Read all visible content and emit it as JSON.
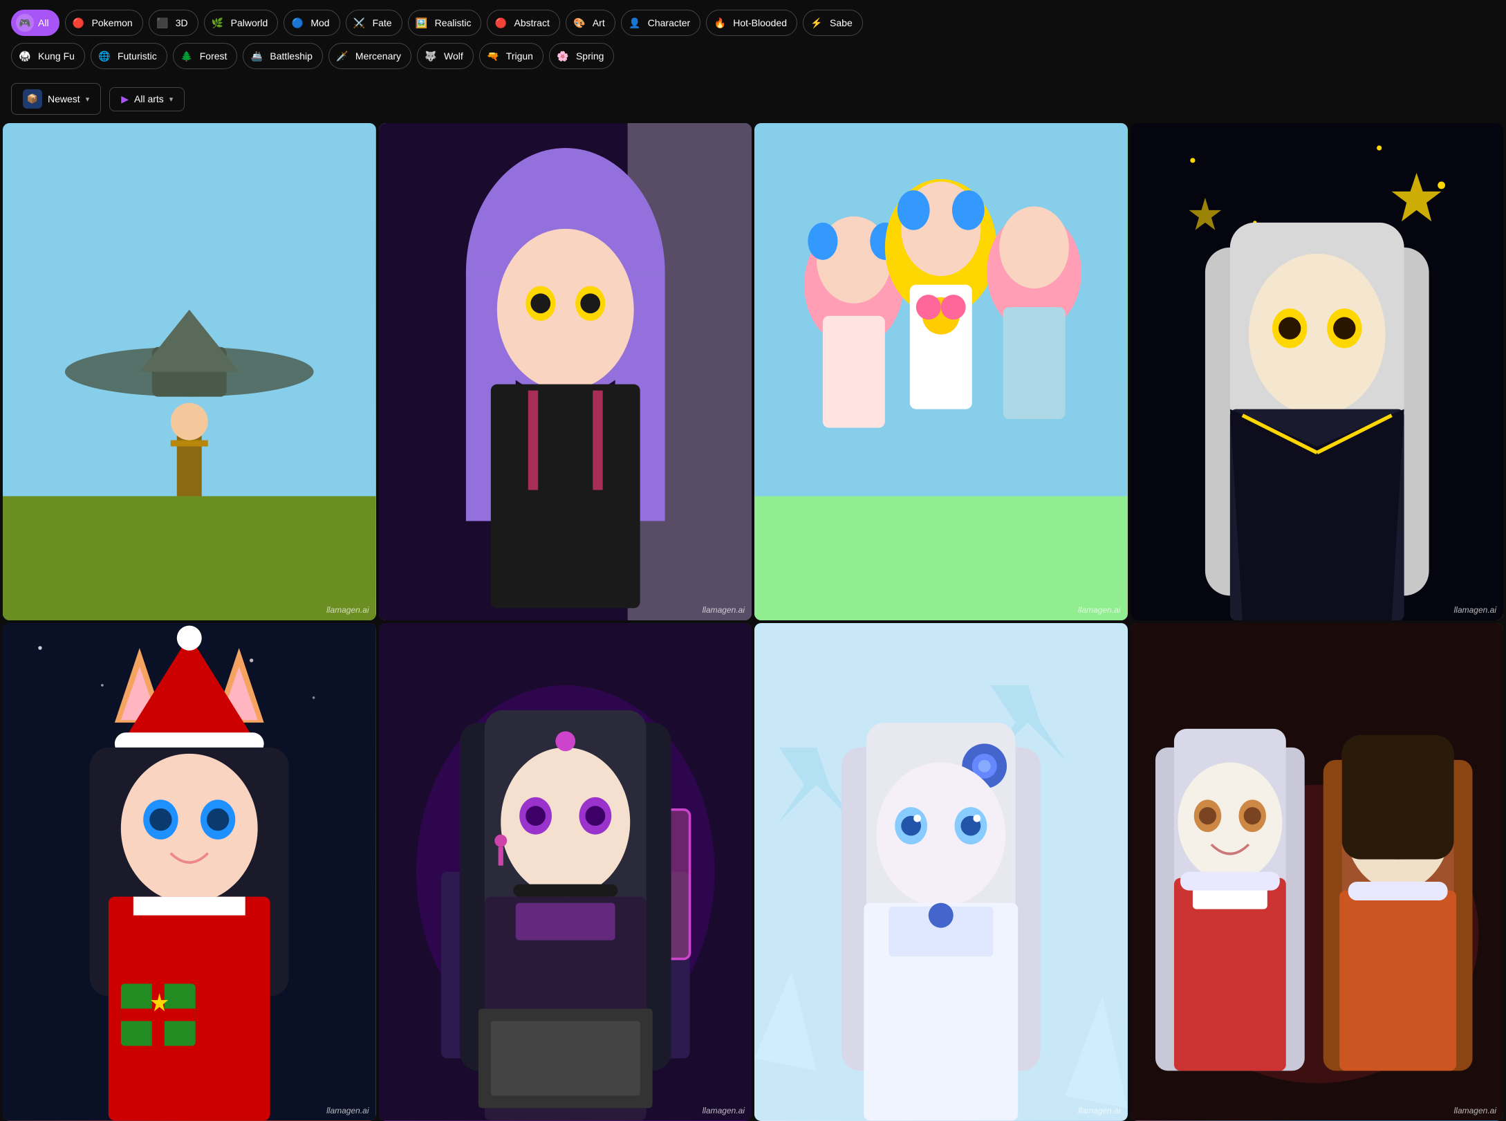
{
  "categories_row1": [
    {
      "id": "all",
      "label": "All",
      "icon": "🎮",
      "active": true
    },
    {
      "id": "pokemon",
      "label": "Pokemon",
      "icon": "🔴"
    },
    {
      "id": "3d",
      "label": "3D",
      "icon": "⬛"
    },
    {
      "id": "palworld",
      "label": "Palworld",
      "icon": "🌿"
    },
    {
      "id": "mod",
      "label": "Mod",
      "icon": "🔵"
    },
    {
      "id": "fate",
      "label": "Fate",
      "icon": "⚔️"
    },
    {
      "id": "realistic",
      "label": "Realistic",
      "icon": "🖼️"
    },
    {
      "id": "abstract",
      "label": "Abstract",
      "icon": "🔴"
    },
    {
      "id": "art",
      "label": "Art",
      "icon": "🎨"
    },
    {
      "id": "character",
      "label": "Character",
      "icon": "👤"
    },
    {
      "id": "hot-blooded",
      "label": "Hot-Blooded",
      "icon": "🔥"
    },
    {
      "id": "sabe",
      "label": "Sabe",
      "icon": "⚡"
    }
  ],
  "categories_row2": [
    {
      "id": "kung-fu",
      "label": "Kung Fu",
      "icon": "🥋"
    },
    {
      "id": "futuristic",
      "label": "Futuristic",
      "icon": "🌐"
    },
    {
      "id": "forest",
      "label": "Forest",
      "icon": "🌲"
    },
    {
      "id": "battleship",
      "label": "Battleship",
      "icon": "🚢"
    },
    {
      "id": "mercenary",
      "label": "Mercenary",
      "icon": "🗡️"
    },
    {
      "id": "wolf",
      "label": "Wolf",
      "icon": "🐺"
    },
    {
      "id": "trigun",
      "label": "Trigun",
      "icon": "🔫"
    },
    {
      "id": "spring",
      "label": "Spring",
      "icon": "🌸"
    }
  ],
  "filters": {
    "sort_label": "Newest",
    "sort_icon": "📦",
    "type_label": "All arts",
    "type_icon": "▶"
  },
  "gallery": {
    "watermark": "llamagen.ai",
    "items": [
      {
        "id": 1,
        "alt": "Pilot with biplane",
        "bg": "img-1"
      },
      {
        "id": 2,
        "alt": "Purple hair anime girl",
        "bg": "img-2"
      },
      {
        "id": 3,
        "alt": "Three anime girls in summer outfits",
        "bg": "img-3"
      },
      {
        "id": 4,
        "alt": "White hair anime girl dark outfit",
        "bg": "img-4"
      },
      {
        "id": 5,
        "alt": "Anime girl Christmas fox",
        "bg": "img-5"
      },
      {
        "id": 6,
        "alt": "Dark hair anime girl at desk",
        "bg": "img-6"
      },
      {
        "id": 7,
        "alt": "Silver hair anime girl ice",
        "bg": "img-7"
      },
      {
        "id": 8,
        "alt": "Two anime girls winter",
        "bg": "img-8"
      }
    ]
  }
}
